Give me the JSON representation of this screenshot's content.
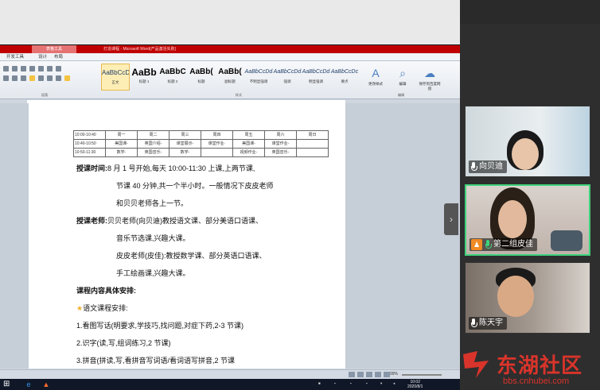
{
  "word": {
    "context_tab": "表格工具",
    "doc_title": "打造课程 - Microsoft Word(产品激活失败)",
    "menu": [
      "开发工具",
      "设计",
      "布局"
    ],
    "styles": [
      {
        "sample": "AaBbCcDd",
        "name": "正文",
        "variant": "normal",
        "active": true
      },
      {
        "sample": "AaBb",
        "name": "标题 1",
        "variant": "big"
      },
      {
        "sample": "AaBbC",
        "name": "标题 2",
        "variant": "mid"
      },
      {
        "sample": "AaBb(",
        "name": "标题",
        "variant": "mid"
      },
      {
        "sample": "AaBb(",
        "name": "副标题",
        "variant": "mid"
      },
      {
        "sample": "AaBbCcDd",
        "name": "不明显强调",
        "variant": "italic"
      },
      {
        "sample": "AaBbCcDd",
        "name": "强调",
        "variant": "italic"
      },
      {
        "sample": "AaBbCcDd",
        "name": "明显强调",
        "variant": "italic"
      },
      {
        "sample": "AaBbCcDc",
        "name": "要点",
        "variant": "italic"
      }
    ],
    "ribbon_buttons": [
      "更改样式",
      "编辑",
      "保存到百度网盘"
    ],
    "ribbon_group_labels": [
      "段落",
      "样式",
      "编辑"
    ]
  },
  "schedule_table": [
    [
      "10:00-10:40",
      "周一",
      "周二",
      "周三",
      "周四",
      "周五",
      "周六",
      "周日"
    ],
    [
      "10:40-10:50",
      "美国课-",
      "英国介绍-",
      "课堂展示-",
      "课堂作业·",
      "美国课-",
      "课堂作业-",
      ""
    ],
    [
      "10:50-11:30",
      "数学-",
      "英国音乐-",
      "数学-",
      "",
      "视频作业-",
      "英国音乐-",
      ""
    ]
  ],
  "doc": {
    "time_label": "授课时间:",
    "time_line1": "8 月 1 号开始,每天 10:00-11:30 上课,上两节课,",
    "time_line2": "节课 40 分钟,共一个半小时。一般情况下皮皮老师",
    "time_line3": "和贝贝老师各上一节。",
    "teacher_label": "授课老师:",
    "teacher_line1": "贝贝老师(向贝迪)教授语文课、部分美语口语课、",
    "teacher_line2": "音乐节选课,兴趣大课。",
    "teacher_line3": "皮皮老师(皮佳):教授数学课、部分英语口语课、",
    "teacher_line4": "手工绘画课,兴趣大课。",
    "content_title": "课程内容具体安排:",
    "chinese_title": "语文课程安排:",
    "item1": "1.看图写话(明要求,学技巧,找问题,对症下药,2-3 节课)",
    "item2": "2.识字(读,写,组词练习,2 节课)",
    "item3": "3.拼音(拼读,写,看拼音写词语/看词语写拼音,2 节课"
  },
  "status_bar": {
    "zoom": "99%"
  },
  "taskbar": {
    "clock_time": "10:02",
    "clock_date": "2020/8/1"
  },
  "participants": [
    {
      "name": "向贝迪",
      "mic": "white",
      "role_badge": false
    },
    {
      "name": "第二组皮佳",
      "mic": "green",
      "role_badge": true
    },
    {
      "name": "陈天宇",
      "mic": "white",
      "role_badge": false
    }
  ],
  "watermark": {
    "title": "东湖社区",
    "url": "bbs.cnhubei.com"
  },
  "colors": {
    "ribbon_red": "#c00000",
    "active_tile": "#3fd27b",
    "watermark": "#d9342b"
  }
}
